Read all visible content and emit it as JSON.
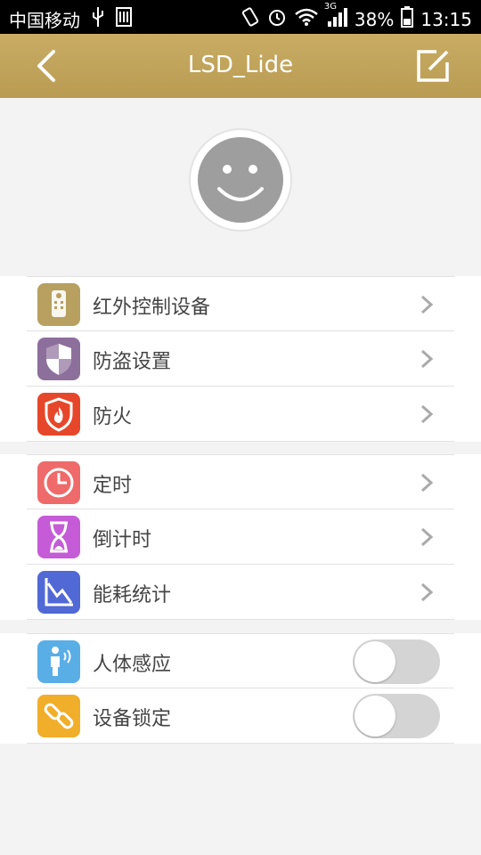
{
  "status_bar": {
    "carrier": "中国移动",
    "network_type": "3G",
    "battery": "38%",
    "time": "13:15"
  },
  "header": {
    "title": "LSD_Lide",
    "back_icon": "chevron-left-icon",
    "edit_icon": "edit-icon"
  },
  "avatar": {
    "icon": "smiley-face-icon"
  },
  "groups": [
    {
      "items": [
        {
          "label": "红外控制设备",
          "icon": "remote-control-icon",
          "icon_color": "#b7a060"
        },
        {
          "label": "防盗设置",
          "icon": "shield-icon",
          "icon_color": "#8d6f9c"
        },
        {
          "label": "防火",
          "icon": "fire-shield-icon",
          "icon_color": "#e6472a"
        }
      ]
    },
    {
      "items": [
        {
          "label": "定时",
          "icon": "clock-icon",
          "icon_color": "#ef6a6a"
        },
        {
          "label": "倒计时",
          "icon": "hourglass-icon",
          "icon_color": "#c55bd6"
        },
        {
          "label": "能耗统计",
          "icon": "chart-icon",
          "icon_color": "#5169d4"
        }
      ]
    },
    {
      "items": [
        {
          "label": "人体感应",
          "icon": "person-sensor-icon",
          "icon_color": "#5aaee6",
          "toggle": false
        },
        {
          "label": "设备锁定",
          "icon": "link-lock-icon",
          "icon_color": "#f0ae2a",
          "toggle": false
        }
      ]
    }
  ]
}
